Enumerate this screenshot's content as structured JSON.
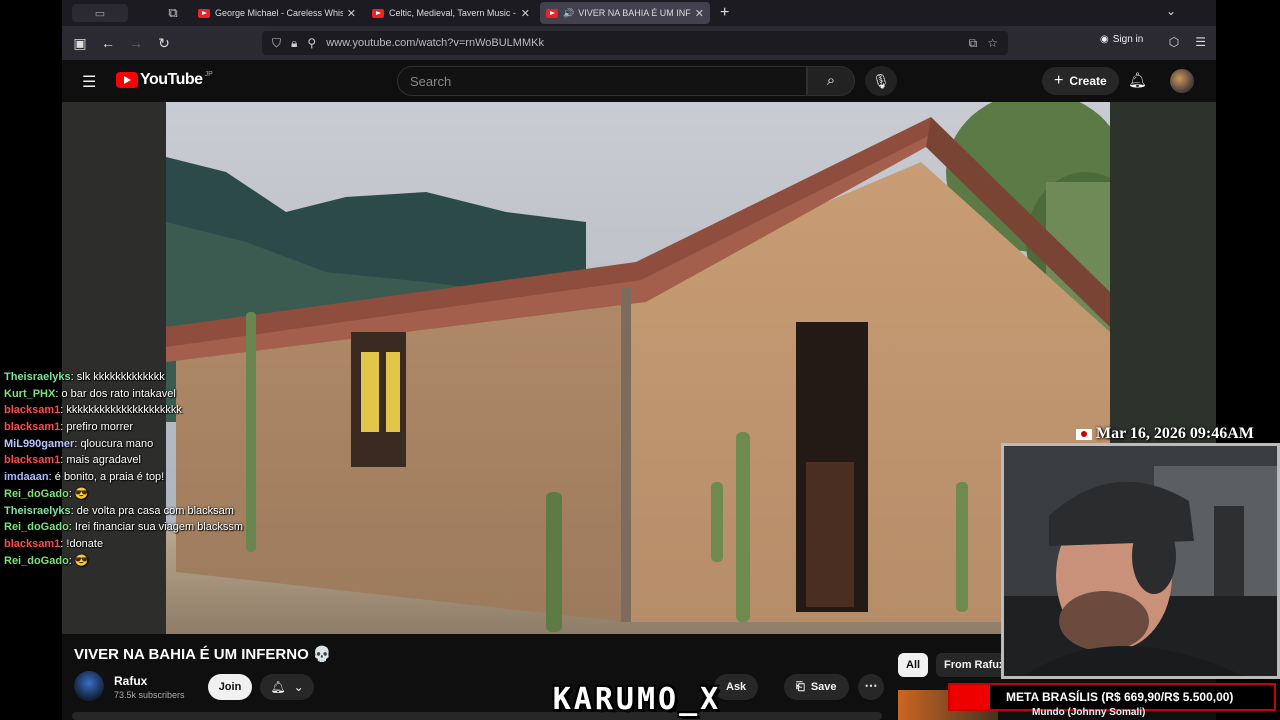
{
  "browser": {
    "tabs": [
      {
        "title": "George Michael - Careless Whis",
        "active": false,
        "audio": false
      },
      {
        "title": "Celtic, Medieval, Tavern Music -",
        "active": false,
        "audio": false
      },
      {
        "title": "VIVER NA BAHIA É UM INFE",
        "active": true,
        "audio": true
      }
    ],
    "url": "www.youtube.com/watch?v=rnWoBULMMKk",
    "sign_in": "Sign in"
  },
  "youtube": {
    "logo": "YouTube",
    "region": "JP",
    "search_placeholder": "Search",
    "create_label": "Create"
  },
  "video": {
    "title": "VIVER NA BAHIA É UM INFERNO 💀",
    "channel": "Rafux",
    "subscribers": "73.5k subscribers",
    "join_label": "Join",
    "ask_label": "Ask",
    "save_label": "Save"
  },
  "sidebar": {
    "chips": [
      "All",
      "From Rafux"
    ],
    "reco_title": "Mundo (Johnny Somali)"
  },
  "stream": {
    "chat": [
      {
        "user": "Theisraelyks",
        "message": "slk kkkkkkkkkkkkk",
        "color": "#7fe0a0"
      },
      {
        "user": "Kurt_PHX",
        "message": "o bar dos rato intakavel",
        "color": "#7fe07a"
      },
      {
        "user": "blacksam1",
        "message": "kkkkkkkkkkkkkkkkkkkkk",
        "color": "#ff4a4a"
      },
      {
        "user": "blacksam1",
        "message": "prefiro morrer",
        "color": "#ff4a4a"
      },
      {
        "user": "MiL990gamer",
        "message": "qloucura mano",
        "color": "#b9c6ff"
      },
      {
        "user": "blacksam1",
        "message": "mais agradavel",
        "color": "#ff4a4a"
      },
      {
        "user": "imdaaan",
        "message": "é bonito, a praia é top!",
        "color": "#a8b8ff"
      },
      {
        "user": "Rei_doGado",
        "message": "😎",
        "color": "#7fe07a"
      },
      {
        "user": "Theisraelyks",
        "message": "de volta pra casa com blacksam",
        "color": "#7fe0a0"
      },
      {
        "user": "Rei_doGado",
        "message": "Irei financiar sua viagem blackssm",
        "color": "#7fe07a"
      },
      {
        "user": "blacksam1",
        "message": "!donate",
        "color": "#ff4a4a"
      },
      {
        "user": "Rei_doGado",
        "message": "😎",
        "color": "#7fe07a"
      }
    ],
    "timestamp": "Mar 16, 2026 09:46AM",
    "goal": "META BRASÍLIS (R$ 669,90/R$ 5.500,00)",
    "watermark": "KARUMO_X"
  }
}
